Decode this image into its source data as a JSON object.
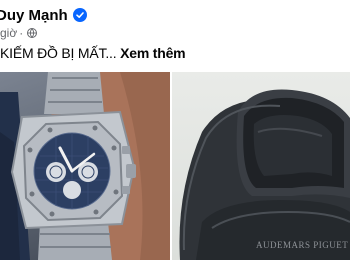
{
  "post": {
    "author": "Duy Mạnh",
    "time": "giờ",
    "caption": "KIẾM ĐỒ BỊ MẤT...",
    "see_more": "Xem thêm",
    "case_brand": "AUDEMARS PIGUET",
    "icons": {
      "verified": "verified-badge-icon",
      "privacy": "globe-icon"
    },
    "colors": {
      "verified": "#0866ff",
      "dial": "#2c3f63"
    }
  }
}
